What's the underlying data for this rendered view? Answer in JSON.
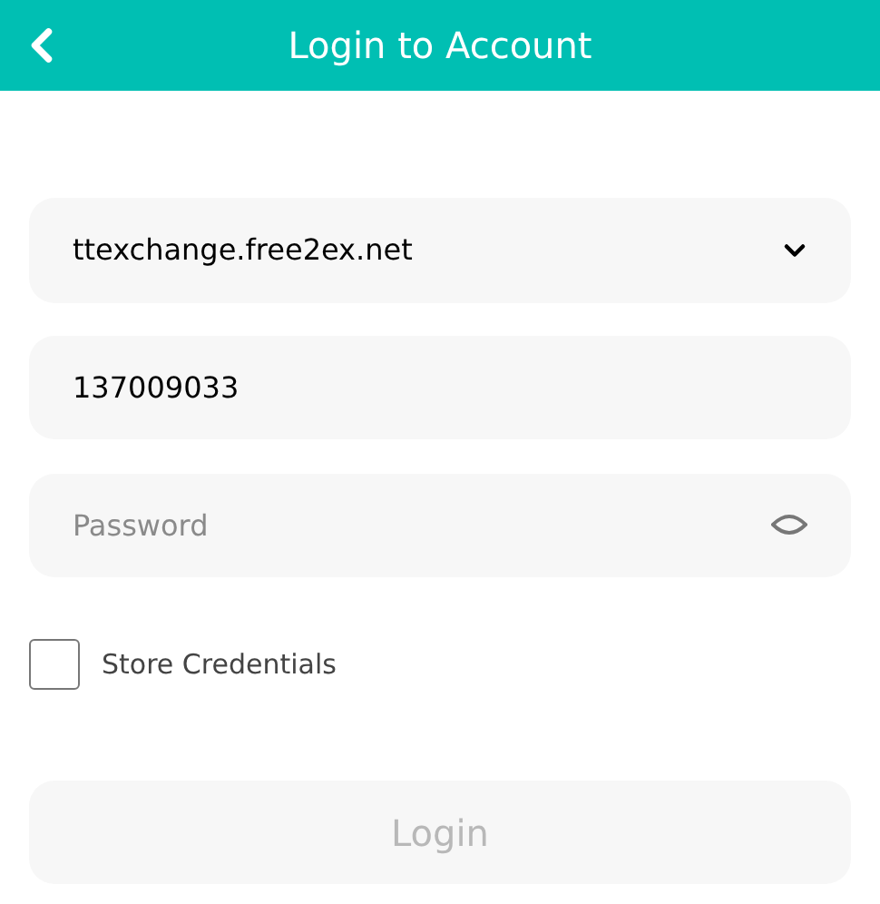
{
  "header": {
    "title": "Login to Account"
  },
  "server": {
    "value": "ttexchange.free2ex.net"
  },
  "login": {
    "value": "137009033"
  },
  "password": {
    "placeholder": "Password"
  },
  "store_credentials": {
    "label": "Store Credentials",
    "checked": false
  },
  "login_button": {
    "label": "Login",
    "disabled": true
  }
}
